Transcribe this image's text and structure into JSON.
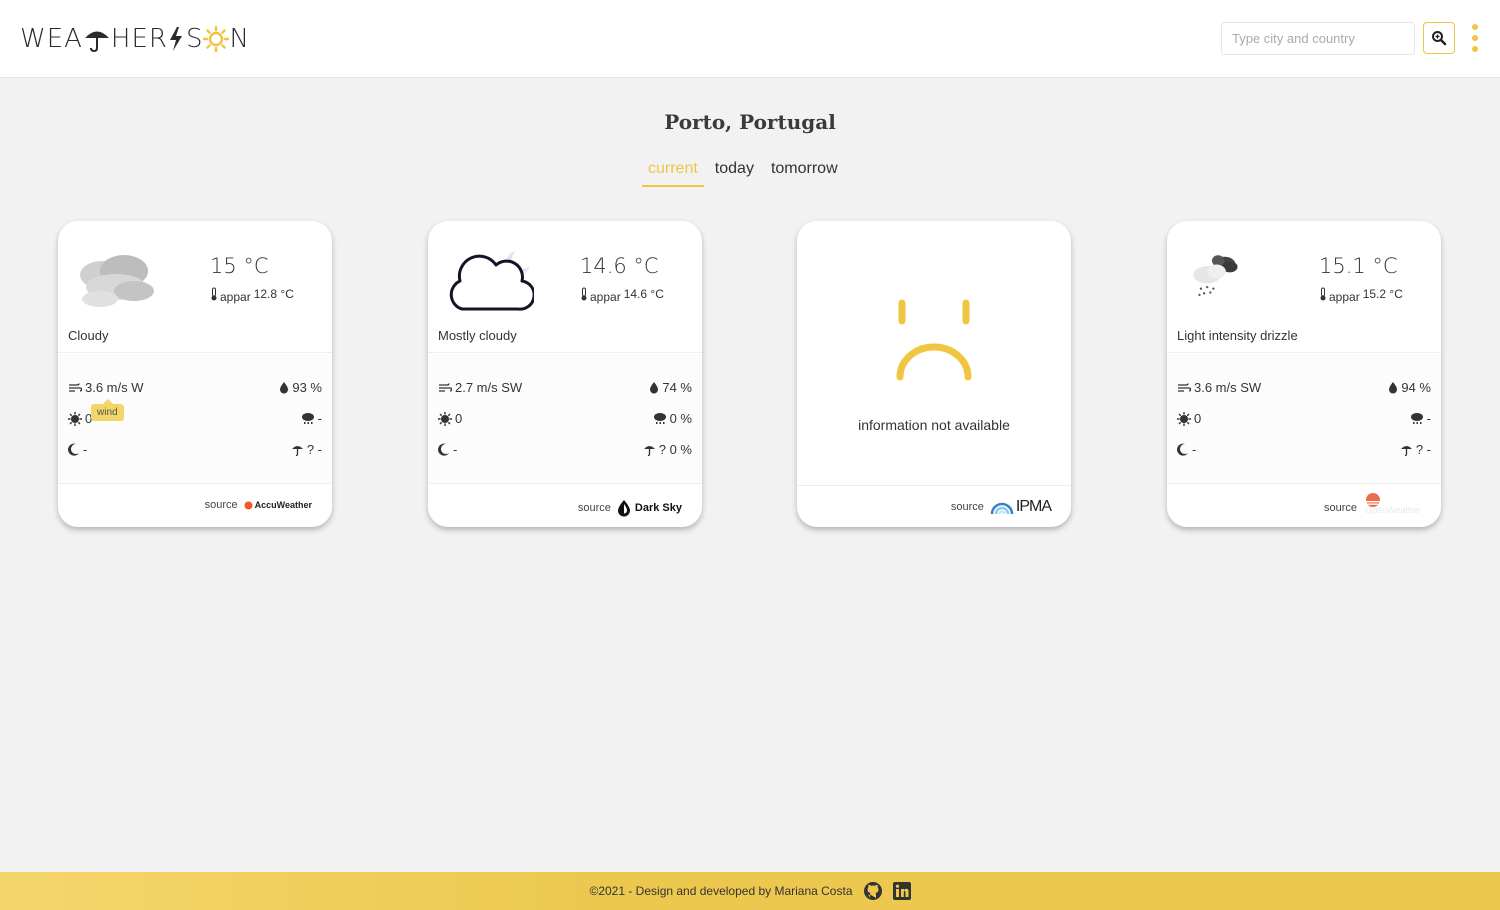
{
  "header": {
    "logo_text_left": "WEA",
    "logo_text_mid": "HER",
    "logo_text_end": "N",
    "search_placeholder": "Type city and country"
  },
  "location": "Porto, Portugal",
  "tabs": [
    {
      "label": "current",
      "active": true
    },
    {
      "label": "today",
      "active": false
    },
    {
      "label": "tomorrow",
      "active": false
    }
  ],
  "cards": [
    {
      "temp": "15 °C",
      "appar_label": "appar",
      "appar": "12.8 °C",
      "description": "Cloudy",
      "wind": "3.6 m/s W",
      "humidity": "93 %",
      "uv": "0",
      "precip": "-",
      "moon": "-",
      "precip_prob": "? -",
      "source_label": "source",
      "source_name": "AccuWeather",
      "icon": "cloudy-icon"
    },
    {
      "temp": "14.6 °C",
      "appar_label": "appar",
      "appar": "14.6 °C",
      "description": "Mostly cloudy",
      "wind": "2.7 m/s SW",
      "humidity": "74 %",
      "uv": "0",
      "precip": "0 %",
      "moon": "-",
      "precip_prob": "? 0 %",
      "source_label": "source",
      "source_name": "Dark Sky",
      "icon": "mostly-cloudy-night-icon"
    },
    {
      "unavailable_text": "information not available",
      "source_label": "source",
      "source_name": "IPMA"
    },
    {
      "temp": "15.1 °C",
      "appar_label": "appar",
      "appar": "15.2 °C",
      "description": "Light intensity drizzle",
      "wind": "3.6 m/s SW",
      "humidity": "94 %",
      "uv": "0",
      "precip": "-",
      "moon": "-",
      "precip_prob": "? -",
      "source_label": "source",
      "source_name": "OpenWeather",
      "icon": "drizzle-icon"
    }
  ],
  "tooltip": "wind",
  "footer": {
    "text": "©2021 - Design and developed by Mariana Costa"
  },
  "colors": {
    "accent": "#f0c542",
    "background": "#f2f2f2",
    "footer": "#ecc84f"
  }
}
